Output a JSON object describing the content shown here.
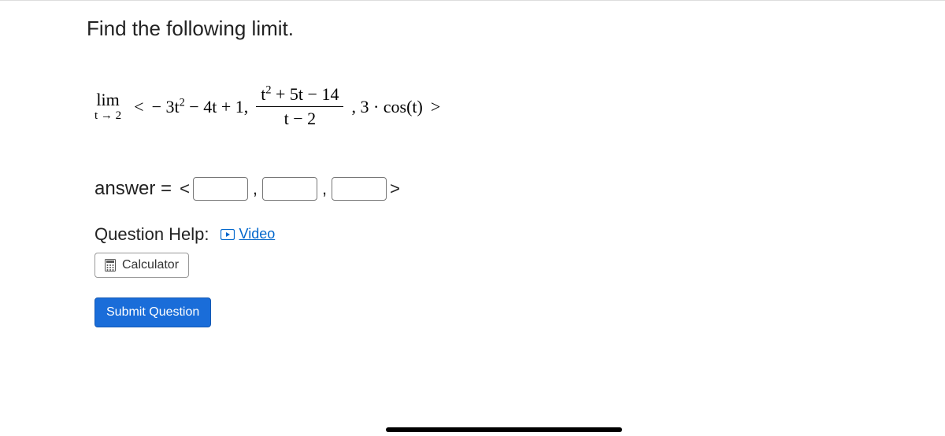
{
  "prompt": "Find the following limit.",
  "math": {
    "lim_label": "lim",
    "lim_approach": "t → 2",
    "open_bracket": "<",
    "expr1_a": "− 3",
    "expr1_b": "t",
    "expr1_sup": "2",
    "expr1_c": " − 4t + 1,  ",
    "frac_num_a": "t",
    "frac_num_sup": "2",
    "frac_num_b": " + 5t − 14",
    "frac_den": "t − 2",
    "expr3": ", 3 · cos(t)",
    "close_bracket": ">"
  },
  "answer": {
    "label": "answer =",
    "open": "<",
    "comma": ",",
    "close": ">"
  },
  "help": {
    "label": "Question Help:",
    "video_label": "Video"
  },
  "calculator_label": "Calculator",
  "submit_label": "Submit Question"
}
